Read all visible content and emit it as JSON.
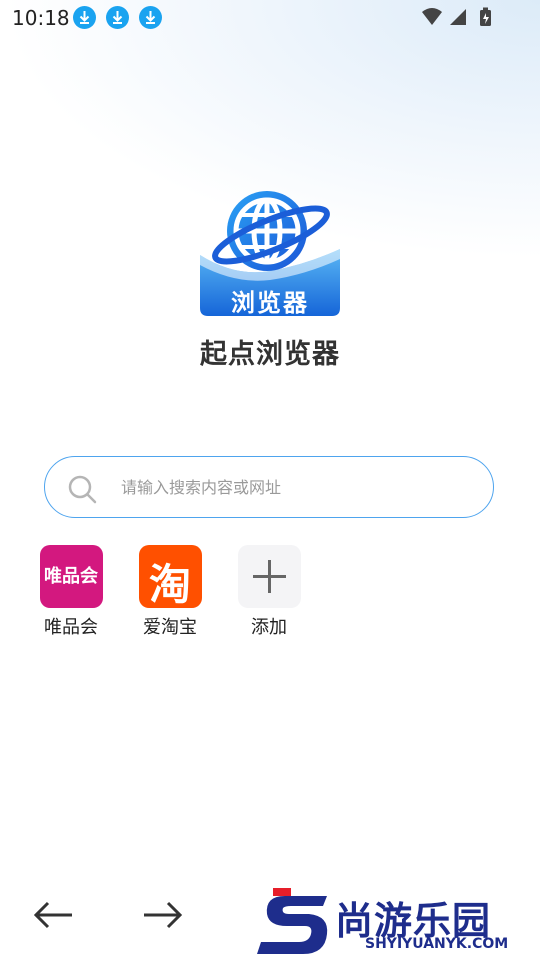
{
  "status_bar": {
    "time": "10:18"
  },
  "app": {
    "logo_text": "浏览器",
    "name": "起点浏览器"
  },
  "search": {
    "placeholder": "请输入搜索内容或网址"
  },
  "shortcuts": [
    {
      "label": "唯品会",
      "icon_text": "唯品会",
      "color": "#d3187f"
    },
    {
      "label": "爱淘宝",
      "icon_text": "淘",
      "color": "#ff5000"
    },
    {
      "label": "添加"
    }
  ],
  "watermark": {
    "text": "尚游乐园",
    "subtext": "SHYIYUANYK.COM"
  },
  "colors": {
    "accent": "#4ea4ee",
    "logo_blue": "#1e7be8"
  }
}
